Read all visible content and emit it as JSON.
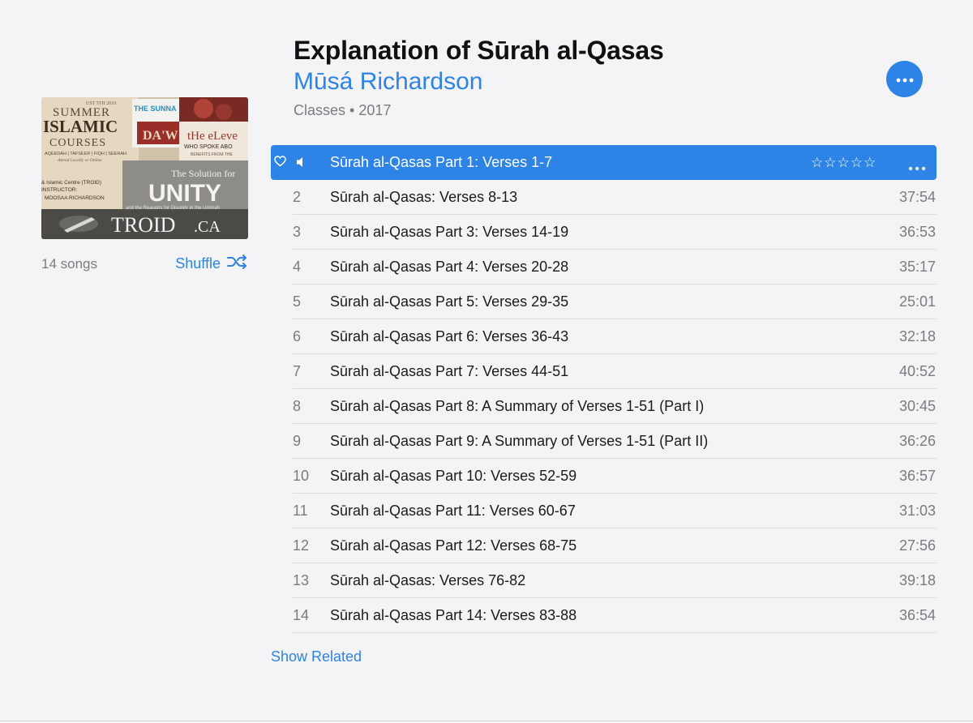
{
  "album": {
    "title": "Explanation of Sūrah al-Qasas",
    "artist": "Mūsá Richardson",
    "meta": "Classes • 2017"
  },
  "sidebar": {
    "songs_count": "14 songs",
    "shuffle_label": "Shuffle"
  },
  "artwork": {
    "summer": "SUMMER",
    "islamic": "ISLAMIC",
    "courses": "COURSES",
    "subjects": "AQEEDAH | TAFSEER | FIQH | SEERAH",
    "attend": "Attend Locally or Online",
    "sunnah": "THE SUNNA",
    "eleven": "tHe eLeve",
    "spoke": "WHO SPOKE ABO",
    "benefits": "BENEFITS FROM THE",
    "solution": "The Solution for",
    "unity": "UNITY",
    "reasons": "and the Reasons for Disunity in the Ummah",
    "centre": "& Islamic Centre (TROID)",
    "instructor": "INSTRUCTOR:",
    "instructor_name": "MOOSAA RICHARDSON",
    "date": "UST 5TH 2010",
    "brand": "TROID",
    "brand_suffix": ".CA"
  },
  "selected_track": {
    "title": "Sūrah al-Qasas Part 1: Verses 1-7",
    "rating": "☆☆☆☆☆"
  },
  "tracks": [
    {
      "num": "2",
      "title": "Sūrah al-Qasas: Verses 8-13",
      "duration": "37:54"
    },
    {
      "num": "3",
      "title": "Sūrah al-Qasas Part 3: Verses 14-19",
      "duration": "36:53"
    },
    {
      "num": "4",
      "title": "Sūrah al-Qasas Part 4: Verses 20-28",
      "duration": "35:17"
    },
    {
      "num": "5",
      "title": "Sūrah al-Qasas Part 5: Verses 29-35",
      "duration": "25:01"
    },
    {
      "num": "6",
      "title": "Sūrah al-Qasas Part 6: Verses 36-43",
      "duration": "32:18"
    },
    {
      "num": "7",
      "title": "Sūrah al-Qasas Part 7: Verses 44-51",
      "duration": "40:52"
    },
    {
      "num": "8",
      "title": "Sūrah al-Qasas Part 8: A Summary of Verses 1-51 (Part I)",
      "duration": "30:45"
    },
    {
      "num": "9",
      "title": "Sūrah al-Qasas Part 9: A Summary of Verses 1-51 (Part II)",
      "duration": "36:26"
    },
    {
      "num": "10",
      "title": "Sūrah al-Qasas Part 10: Verses 52-59",
      "duration": "36:57"
    },
    {
      "num": "11",
      "title": "Sūrah al-Qasas Part 11: Verses 60-67",
      "duration": "31:03"
    },
    {
      "num": "12",
      "title": "Sūrah al-Qasas Part 12: Verses 68-75",
      "duration": "27:56"
    },
    {
      "num": "13",
      "title": "Sūrah al-Qasas: Verses 76-82",
      "duration": "39:18"
    },
    {
      "num": "14",
      "title": "Sūrah al-Qasas Part 14: Verses 83-88",
      "duration": "36:54"
    }
  ],
  "footer": {
    "show_related": "Show Related"
  },
  "colors": {
    "accent": "#2d84e6",
    "background": "#f4f4f6",
    "secondary_text": "#7c7c80"
  },
  "icons": {
    "heart": "heart-icon",
    "speaker": "speaker-icon",
    "more": "more-icon",
    "shuffle": "shuffle-icon"
  }
}
